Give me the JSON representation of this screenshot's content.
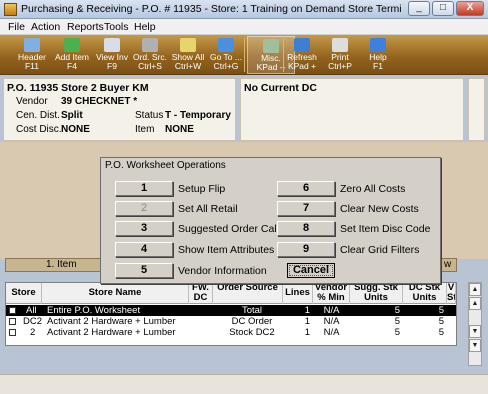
{
  "window": {
    "title": "Purchasing & Receiving - P.O. # 11935 - Store: 1  Training on Demand Store  Terminal: 203  Signed ...",
    "minimize": "_",
    "maximize": "□",
    "close": "X"
  },
  "menu": [
    "File",
    "Action",
    "Reports",
    "Tools",
    "Help"
  ],
  "toolbar": [
    {
      "l1": "Header",
      "l2": "F11",
      "icon": "header-icon",
      "color": "#7fb0e0"
    },
    {
      "l1": "Add Item",
      "l2": "F4",
      "icon": "add-item-icon",
      "color": "#4caf50"
    },
    {
      "l1": "View Inv",
      "l2": "F9",
      "icon": "view-inventory-icon",
      "color": "#d7dee8"
    },
    {
      "l1": "Ord. Src.",
      "l2": "Ctrl+S",
      "icon": "order-source-icon",
      "color": "#b0b0b0"
    },
    {
      "l1": "Show All",
      "l2": "Ctrl+W",
      "icon": "eye-icon",
      "color": "#e9d36b"
    },
    {
      "l1": "Go To ...",
      "l2": "Ctrl+G",
      "icon": "goto-icon",
      "color": "#4b8fe0"
    },
    {
      "l1": "Misc.",
      "l2": "KPad --",
      "icon": "misc-icon",
      "color": "#9fbf9f"
    },
    {
      "l1": "Refresh",
      "l2": "KPad +",
      "icon": "refresh-icon",
      "color": "#3d7fd0"
    },
    {
      "l1": "Print",
      "l2": "Ctrl+P",
      "icon": "printer-icon",
      "color": "#dddddd"
    },
    {
      "l1": "Help",
      "l2": "F1",
      "icon": "help-icon",
      "color": "#3f7fe0"
    }
  ],
  "po_panel": {
    "title": "P.O. 11935 Store 2 Buyer KM",
    "vendor_label": "Vendor",
    "vendor_value": "39 CHECKNET *",
    "cen_label": "Cen. Dist.",
    "cen_value": "Split",
    "status_label": "Status",
    "status_value": "T - Temporary",
    "cost_label": "Cost Disc.",
    "cost_value": "NONE",
    "item_label": "Item",
    "item_value": "NONE"
  },
  "dc_panel": {
    "title": "No Current DC"
  },
  "tab": {
    "label": "1. Item",
    "right": "w"
  },
  "grid": {
    "headers": [
      "Store",
      "Store Name",
      "FW. DC",
      "Order Source",
      "Lines",
      "Vendor % Min",
      "Sugg. Stk Units",
      "DC Stk Units",
      "V St"
    ],
    "rows": [
      {
        "store": "All",
        "name": "Entire P.O. Worksheet",
        "fw": "",
        "source": "Total",
        "lines": "1",
        "vmin": "N/A",
        "sugg": "5",
        "dcstk": "5",
        "sel": true
      },
      {
        "store": "DC2",
        "name": "Activant 2 Hardware + Lumber",
        "fw": "",
        "source": "DC Order",
        "lines": "1",
        "vmin": "N/A",
        "sugg": "5",
        "dcstk": "5",
        "sel": false
      },
      {
        "store": "2",
        "name": "Activant 2 Hardware + Lumber",
        "fw": "",
        "source": "Stock DC2",
        "lines": "1",
        "vmin": "N/A",
        "sugg": "5",
        "dcstk": "5",
        "sel": false
      }
    ]
  },
  "dialog": {
    "title": "P.O. Worksheet Operations",
    "options": [
      {
        "key": "1",
        "label": "Setup Flip",
        "enabled": true
      },
      {
        "key": "2",
        "label": "Set All Retail",
        "enabled": false
      },
      {
        "key": "3",
        "label": "Suggested Order Calc",
        "enabled": true
      },
      {
        "key": "4",
        "label": "Show Item Attributes",
        "enabled": true
      },
      {
        "key": "5",
        "label": "Vendor Information",
        "enabled": true
      },
      {
        "key": "6",
        "label": "Zero All Costs",
        "enabled": true
      },
      {
        "key": "7",
        "label": "Clear New Costs",
        "enabled": true
      },
      {
        "key": "8",
        "label": "Set Item Disc Code",
        "enabled": true
      },
      {
        "key": "9",
        "label": "Clear Grid Filters",
        "enabled": true
      }
    ],
    "cancel": "Cancel"
  }
}
